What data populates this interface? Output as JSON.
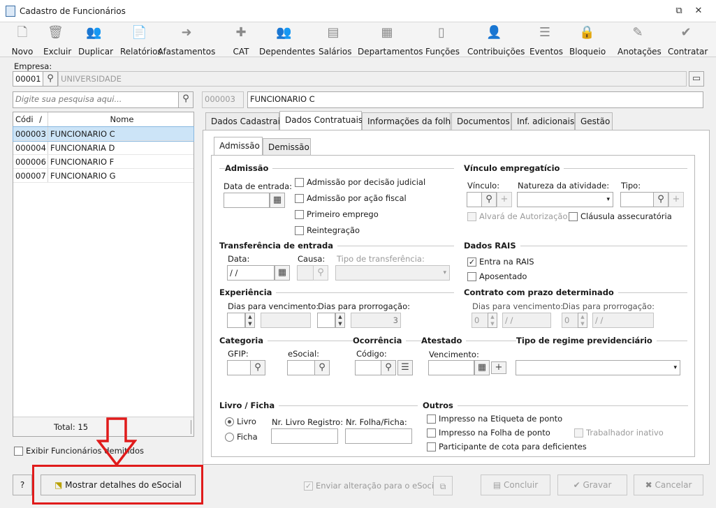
{
  "window": {
    "title": "Cadastro de Funcionários",
    "restore_glyph": "⧉",
    "close_glyph": "✕"
  },
  "toolbar": {
    "items": [
      {
        "label": "Novo",
        "icon": "new-document-icon",
        "glyph": "🗋"
      },
      {
        "label": "Excluir",
        "icon": "trash-icon",
        "glyph": "🗑"
      },
      {
        "label": "Duplicar",
        "icon": "duplicate-users-icon",
        "glyph": "👥"
      },
      {
        "label": "Relatórios",
        "icon": "report-icon",
        "glyph": "📄"
      },
      {
        "label": "Afastamentos",
        "icon": "leave-arrow-house-icon",
        "glyph": "➜"
      },
      {
        "label": "CAT",
        "icon": "medical-cross-icon",
        "glyph": "✚"
      },
      {
        "label": "Dependentes",
        "icon": "dependents-icon",
        "glyph": "👥"
      },
      {
        "label": "Salários",
        "icon": "money-icon",
        "glyph": "▤"
      },
      {
        "label": "Departamentos",
        "icon": "desk-icon",
        "glyph": "▦"
      },
      {
        "label": "Funções",
        "icon": "badge-icon",
        "glyph": "▯"
      },
      {
        "label": "Contribuições",
        "icon": "people-icon",
        "glyph": "👤"
      },
      {
        "label": "Eventos",
        "icon": "list-icon",
        "glyph": "☰"
      },
      {
        "label": "Bloqueio",
        "icon": "lock-icon",
        "glyph": "🔒"
      },
      {
        "label": "Anotações",
        "icon": "notes-check-icon",
        "glyph": "✎"
      },
      {
        "label": "Contratar",
        "icon": "contract-check-icon",
        "glyph": "✔"
      }
    ]
  },
  "empresa": {
    "label": "Empresa:",
    "code": "00001",
    "name": "UNIVERSIDADE"
  },
  "search": {
    "placeholder": "Digite sua pesquisa aqui..."
  },
  "current": {
    "code": "000003",
    "name": "FUNCIONARIO C"
  },
  "grid": {
    "col_code": "Códi",
    "col_name": "Nome",
    "sort_glyph": "/",
    "rows": [
      {
        "code": "000003",
        "name": "FUNCIONARIO C"
      },
      {
        "code": "000004",
        "name": "FUNCIONARIA D"
      },
      {
        "code": "000006",
        "name": "FUNCIONARIO F"
      },
      {
        "code": "000007",
        "name": "FUNCIONARIO G"
      }
    ],
    "total": "Total: 15"
  },
  "show_dismissed": "Exibir Funcionários demitidos",
  "tabs": [
    "Dados Cadastrais",
    "Dados Contratuais",
    "Informações da folha",
    "Documentos",
    "Inf. adicionais",
    "Gestão"
  ],
  "subtabs": [
    "Admissão",
    "Demissão"
  ],
  "admissao": {
    "title": "Admissão",
    "date_label": "Data de entrada:",
    "checks": [
      "Admissão por decisão judicial",
      "Admissão por ação fiscal",
      "Primeiro emprego",
      "Reintegração"
    ]
  },
  "vinculo": {
    "title": "Vínculo empregatício",
    "vinculo_label": "Vínculo:",
    "natureza_label": "Natureza da atividade:",
    "tipo_label": "Tipo:",
    "alvara": "Alvará de Autorização",
    "clausula": "Cláusula assecuratória"
  },
  "transferencia": {
    "title": "Transferência de entrada",
    "data_label": "Data:",
    "data_value": "/ /",
    "causa_label": "Causa:",
    "tipo_label": "Tipo de transferência:"
  },
  "rais": {
    "title": "Dados RAIS",
    "entra": "Entra na RAIS",
    "aposentado": "Aposentado"
  },
  "experiencia": {
    "title": "Experiência",
    "venc_label": "Dias para vencimento:",
    "prorr_label": "Dias para prorrogação:",
    "prorr_value": "3"
  },
  "contrato": {
    "title": "Contrato com prazo determinado",
    "venc_label": "Dias para vencimento:",
    "prorr_label": "Dias para prorrogação:",
    "zero": "0",
    "date": "/ /"
  },
  "categoria": {
    "title": "Categoria",
    "gfip_label": "GFIP:",
    "esocial_label": "eSocial:"
  },
  "ocorrencia": {
    "title": "Ocorrência",
    "codigo_label": "Código:"
  },
  "atestado": {
    "title": "Atestado",
    "venc_label": "Vencimento:"
  },
  "regime": {
    "title": "Tipo de regime previdenciário"
  },
  "livro": {
    "title": "Livro / Ficha",
    "livro": "Livro",
    "ficha": "Ficha",
    "nr_livro": "Nr. Livro Registro:",
    "nr_folha": "Nr. Folha/Ficha:"
  },
  "outros": {
    "title": "Outros",
    "checks": [
      "Impresso na Etiqueta de ponto",
      "Impresso na Folha de ponto",
      "Participante de cota para deficientes"
    ],
    "inativo": "Trabalhador inativo"
  },
  "bottom": {
    "help": "?",
    "esocial_btn": "Mostrar detalhes do eSocial",
    "enviar": "Enviar alteração para o eSocial",
    "concluir": "Concluir",
    "gravar": "Gravar",
    "cancelar": "Cancelar"
  },
  "colors": {
    "annotation_red": "#e01b1b",
    "selected_row": "#cce4f7"
  }
}
